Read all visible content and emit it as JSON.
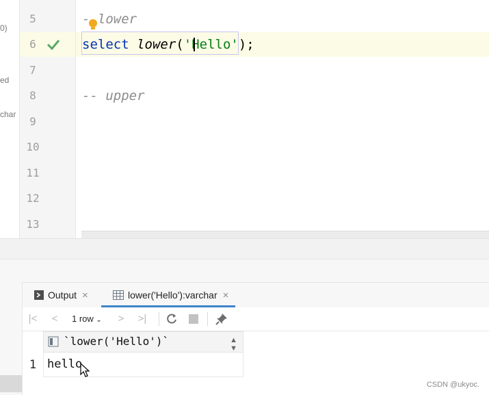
{
  "side_panel": {
    "fragments": [
      "0)",
      "ed",
      "char"
    ]
  },
  "editor": {
    "line_numbers": [
      "5",
      "6",
      "7",
      "8",
      "9",
      "10",
      "11",
      "12",
      "13"
    ],
    "lines": {
      "l5_comment": "- lower",
      "l6_kw": "select",
      "l6_fn": "lower",
      "l6_open": "(",
      "l6_str": "'Hello'",
      "l6_close": ");",
      "l8_comment": "-- upper"
    }
  },
  "tool_window": {
    "tabs": [
      {
        "label": "Output"
      },
      {
        "label": "lower('Hello'):varchar"
      }
    ],
    "toolbar": {
      "rows_label": "1 row"
    },
    "grid": {
      "columns": [
        "`lower('Hello')`"
      ],
      "rows": [
        {
          "num": "1",
          "values": [
            "hello"
          ]
        }
      ]
    }
  },
  "watermark": "CSDN @ukyoc.",
  "colors": {
    "keyword": "#0033b3",
    "string": "#067d17",
    "comment": "#8c8c8c",
    "success_check": "#59a869",
    "accent_tab": "#4083c9"
  }
}
